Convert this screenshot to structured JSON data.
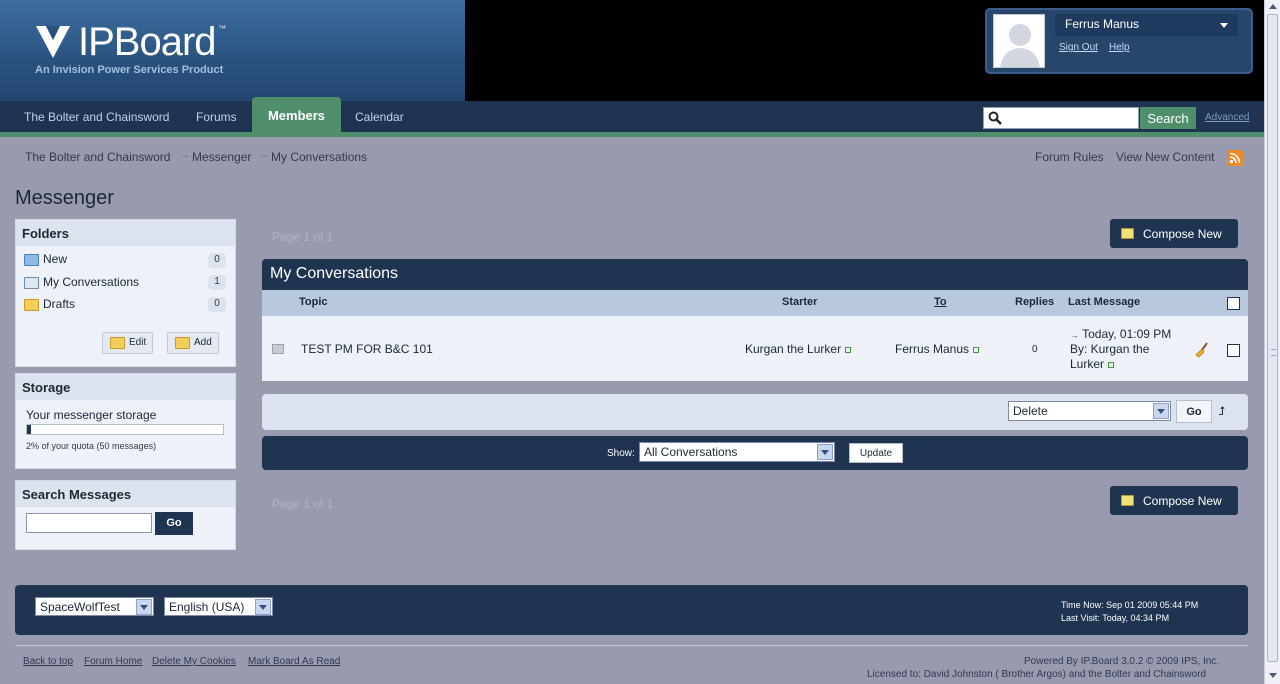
{
  "header": {
    "logo_text": "IPBoard",
    "logo_tm": "™",
    "tagline": "An Invision Power Services Product",
    "user_name": "Ferrus Manus",
    "sign_out": "Sign Out",
    "help": "Help"
  },
  "nav": {
    "tabs": [
      "The Bolter and Chainsword",
      "Forums",
      "Members",
      "Calendar"
    ],
    "active": "Members",
    "search_button": "Search",
    "advanced": "Advanced"
  },
  "breadcrumb": [
    "The Bolter and Chainsword",
    "Messenger",
    "My Conversations"
  ],
  "top_links": {
    "forum_rules": "Forum Rules",
    "view_new": "View New Content"
  },
  "page_title": "Messenger",
  "sidebar": {
    "folders_title": "Folders",
    "folders": [
      {
        "label": "New",
        "count": "0"
      },
      {
        "label": "My Conversations",
        "count": "1"
      },
      {
        "label": "Drafts",
        "count": "0"
      }
    ],
    "edit_label": "Edit",
    "add_label": "Add",
    "storage_title": "Storage",
    "storage_text": "Your messenger storage",
    "storage_fraction": 0.02,
    "storage_quota": "2% of your quota (50 messages)",
    "search_title": "Search Messages",
    "search_go": "Go"
  },
  "main": {
    "page_of": "Page 1 of 1",
    "compose": "Compose New",
    "table_title": "My Conversations",
    "columns": {
      "topic": "Topic",
      "starter": "Starter",
      "to": "To",
      "replies": "Replies",
      "last": "Last Message"
    },
    "row": {
      "topic": "TEST PM FOR B&C 101",
      "starter": "Kurgan the Lurker",
      "to": "Ferrus Manus",
      "replies": "0",
      "last_time": "Today, 01:09 PM",
      "last_by_1": "By: Kurgan the",
      "last_by_2": "Lurker"
    },
    "action_select": "Delete",
    "action_go": "Go",
    "show_label": "Show:",
    "show_select": "All Conversations",
    "update": "Update"
  },
  "footer": {
    "skin": "SpaceWolfTest",
    "language": "English (USA)",
    "time_now": "Time Now: Sep 01 2009 05:44 PM",
    "last_visit": "Last Visit: Today, 04:34 PM",
    "links": [
      "Back to top",
      "Forum Home",
      "Delete My Cookies",
      "Mark Board As Read"
    ],
    "powered": "Powered By IP.Board 3.0.2 © 2009  IPS, Inc.",
    "licensed": "Licensed to: David Johnston ( Brother Argos) and the Bolter and Chainsword"
  },
  "colors": {
    "accent_green": "#4f8f6c",
    "navy": "#1f3450",
    "page_bg": "#9a9aae"
  }
}
